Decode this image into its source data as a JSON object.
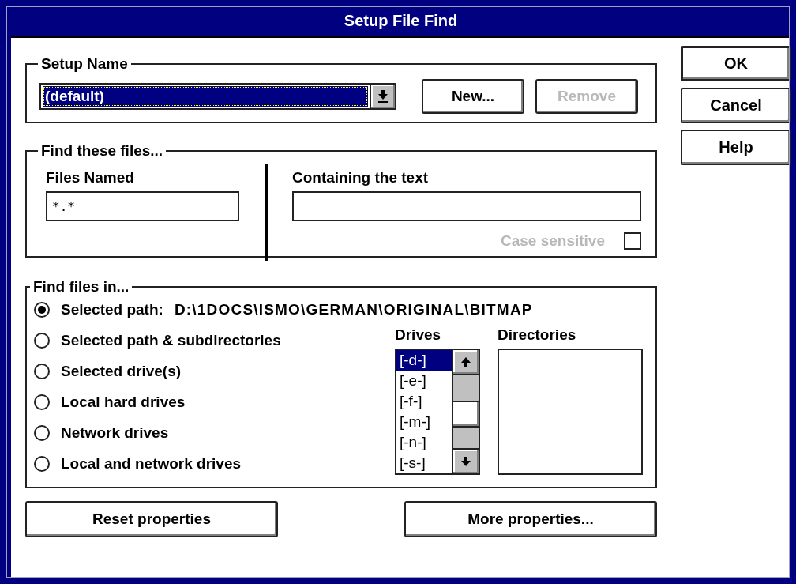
{
  "window": {
    "title": "Setup File Find"
  },
  "setup_name": {
    "label": "Setup Name",
    "value": "(default)",
    "buttons": [
      {
        "label": "New...",
        "disabled": false
      },
      {
        "label": "Remove",
        "disabled": true
      }
    ]
  },
  "find_these_files": {
    "label": "Find these files...",
    "files_named": {
      "label": "Files Named",
      "value": "*.*"
    },
    "containing_text": {
      "label": "Containing the text"
    },
    "case_sensitive": {
      "label": "Case sensitive",
      "checked": false,
      "disabled": true
    }
  },
  "find_files_in": {
    "label": "Find files in...",
    "path": "D:\\1DOCS\\ISMO\\GERMAN\\ORIGINAL\\BITMAP",
    "options": [
      {
        "label": "Selected path:",
        "selected": true
      },
      {
        "label": "Selected path & subdirectories",
        "selected": false
      },
      {
        "label": "Selected drive(s)",
        "selected": false
      },
      {
        "label": "Local hard drives",
        "selected": false
      },
      {
        "label": "Network drives",
        "selected": false
      },
      {
        "label": "Local and network drives",
        "selected": false
      }
    ],
    "drives": {
      "label": "Drives",
      "items": [
        {
          "label": "[-d-]",
          "selected": true
        },
        {
          "label": "[-e-]",
          "selected": false
        },
        {
          "label": "[-f-]",
          "selected": false
        },
        {
          "label": "[-m-]",
          "selected": false
        },
        {
          "label": "[-n-]",
          "selected": false
        },
        {
          "label": "[-s-]",
          "selected": false
        }
      ]
    },
    "directories": {
      "label": "Directories"
    }
  },
  "bottom_buttons": [
    "Reset properties",
    "More properties..."
  ],
  "dialog_buttons": [
    {
      "label": "OK",
      "default": true
    },
    {
      "label": "Cancel",
      "default": false
    },
    {
      "label": "Help",
      "default": false
    }
  ]
}
